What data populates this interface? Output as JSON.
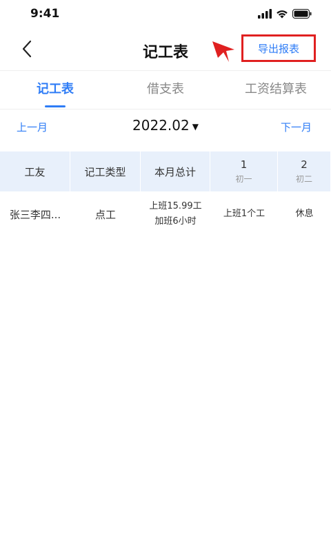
{
  "status_bar": {
    "time": "9:41"
  },
  "nav": {
    "title": "记工表",
    "export_label": "导出报表",
    "annotation_color": "#e02020"
  },
  "tabs": [
    {
      "label": "记工表",
      "active": true
    },
    {
      "label": "借支表",
      "active": false
    },
    {
      "label": "工资结算表",
      "active": false
    }
  ],
  "month": {
    "prev_label": "上一月",
    "current": "2022.02",
    "next_label": "下一月"
  },
  "table": {
    "headers": {
      "worker": "工友",
      "type": "记工类型",
      "total": "本月总计",
      "day1": "1",
      "day1_lunar": "初一",
      "day2": "2",
      "day2_lunar": "初二"
    },
    "rows": [
      {
        "worker": "张三李四...",
        "type": "点工",
        "total_line1": "上班15.99工",
        "total_line2": "加班6小时",
        "day1": "上班1个工",
        "day2": "休息"
      }
    ]
  },
  "colors": {
    "accent": "#2e7cf6",
    "header_bg": "#e8f0fb"
  }
}
